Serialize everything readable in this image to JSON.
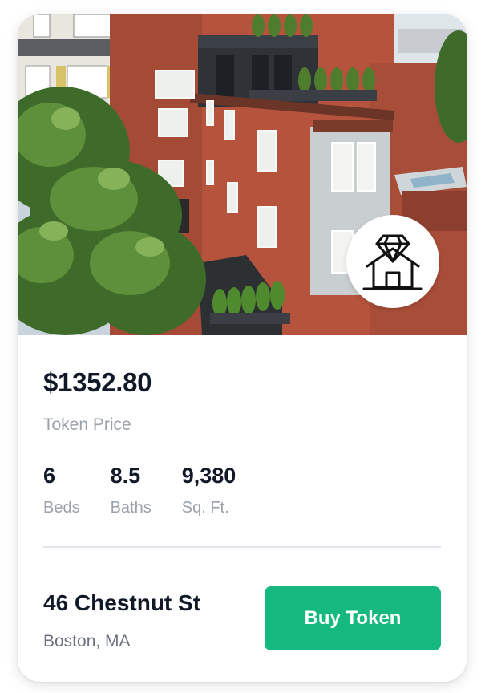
{
  "listing": {
    "price": "$1352.80",
    "price_label": "Token Price",
    "stats": [
      {
        "value": "6",
        "label": "Beds"
      },
      {
        "value": "8.5",
        "label": "Baths"
      },
      {
        "value": "9,380",
        "label": "Sq. Ft."
      }
    ],
    "address": "46 Chestnut St",
    "city": "Boston, MA",
    "buy_label": "Buy Token",
    "badge_icon": "diamond-house-icon"
  },
  "colors": {
    "accent": "#16b97d",
    "text_dark": "#111827",
    "text_muted": "#9aa1ab",
    "brick": "#b5533c"
  }
}
